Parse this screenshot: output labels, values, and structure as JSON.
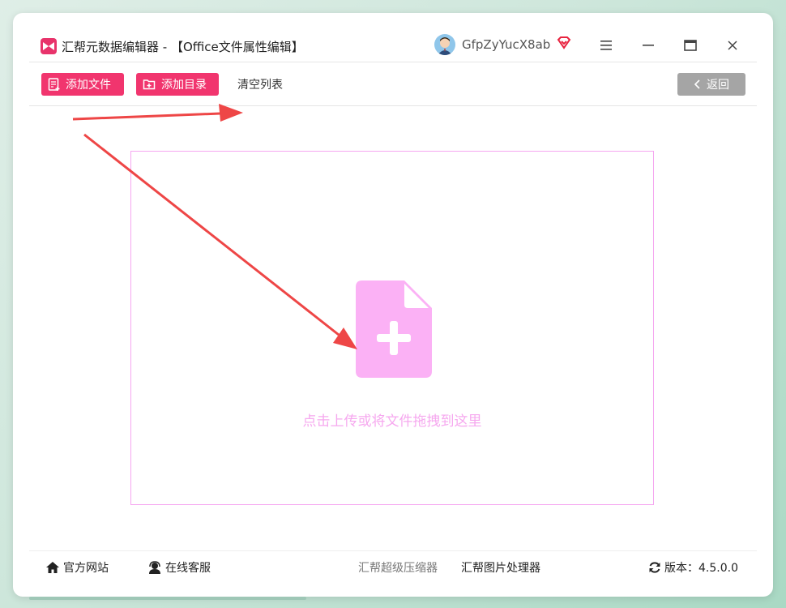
{
  "window": {
    "title": "汇帮元数据编辑器 - 【Office文件属性编辑】",
    "username": "GfpZyYucX8ab"
  },
  "toolbar": {
    "add_file_label": "添加文件",
    "add_folder_label": "添加目录",
    "clear_list_label": "清空列表",
    "back_label": "返回"
  },
  "dropzone": {
    "hint": "点击上传或将文件拖拽到这里"
  },
  "footer": {
    "website_label": "官方网站",
    "service_label": "在线客服",
    "compressor_label": "汇帮超级压缩器",
    "image_tool_label": "汇帮图片处理器",
    "version_label": "版本：4.5.0.0"
  },
  "colors": {
    "accent": "#f1356e",
    "dropzone_border": "#f5a6f0",
    "file_icon": "#fbb1f5",
    "arrow": "#ee4646",
    "back_button": "#a5a5a5"
  },
  "icons": {
    "app_logo": "bowtie-logo-icon",
    "vip": "diamond-heart-icon",
    "menu": "hamburger-menu-icon",
    "minimize": "minimize-icon",
    "maximize": "maximize-icon",
    "close": "close-icon",
    "add_file": "add-file-icon",
    "add_folder": "add-folder-icon",
    "back": "chevron-left-icon",
    "upload": "file-plus-icon",
    "home": "home-icon",
    "service": "headset-icon",
    "refresh": "refresh-icon"
  }
}
